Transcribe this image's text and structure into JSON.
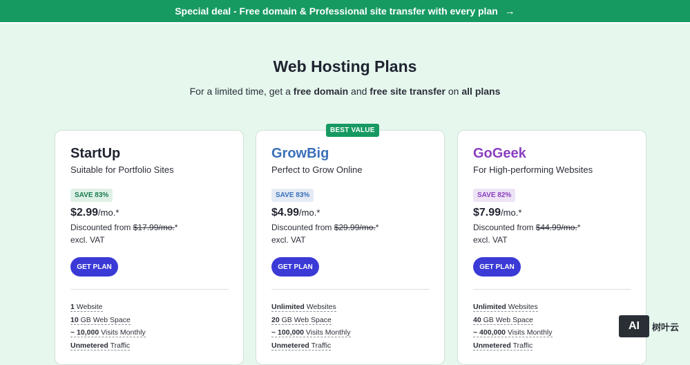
{
  "banner": {
    "text": "Special deal - Free domain & Professional site transfer with every plan",
    "arrow_icon": "→"
  },
  "header": {
    "title": "Web Hosting Plans",
    "subtitle": {
      "p1": "For a limited time, get a ",
      "b1": "free domain",
      "p2": " and ",
      "b2": "free site transfer",
      "p3": " on ",
      "b3": "all plans"
    }
  },
  "best_value_badge": "BEST VALUE",
  "plans": [
    {
      "name": "StartUp",
      "name_color": "#1f2330",
      "desc": "Suitable for Portfolio Sites",
      "save": "SAVE 83%",
      "save_bg": "#dff1e6",
      "save_color": "#1a7a4f",
      "price": "$2.99",
      "per": "/mo.*",
      "disc_prefix": "Discounted from ",
      "orig_price": "$17.99/mo.",
      "disc_suffix": "*",
      "vat": "excl. VAT",
      "button": "GET PLAN",
      "features": [
        {
          "value": "1",
          "label": " Website"
        },
        {
          "value": "10",
          "label": " GB Web Space"
        },
        {
          "value": "~ 10,000",
          "label": " Visits Monthly"
        },
        {
          "value": "Unmetered",
          "label": " Traffic"
        }
      ]
    },
    {
      "name": "GrowBig",
      "name_color": "#3a6fb8",
      "desc": "Perfect to Grow Online",
      "save": "SAVE 83%",
      "save_bg": "#e4ebf5",
      "save_color": "#3a6fb8",
      "price": "$4.99",
      "per": "/mo.*",
      "disc_prefix": "Discounted from ",
      "orig_price": "$29.99/mo.",
      "disc_suffix": "*",
      "vat": "excl. VAT",
      "button": "GET PLAN",
      "features": [
        {
          "value": "Unlimited",
          "label": " Websites"
        },
        {
          "value": "20",
          "label": " GB Web Space"
        },
        {
          "value": "~ 100,000",
          "label": " Visits Monthly"
        },
        {
          "value": "Unmetered",
          "label": " Traffic"
        }
      ]
    },
    {
      "name": "GoGeek",
      "name_color": "#8a3fc1",
      "desc": "For High-performing Websites",
      "save": "SAVE 82%",
      "save_bg": "#ede3f5",
      "save_color": "#8a3fc1",
      "price": "$7.99",
      "per": "/mo.*",
      "disc_prefix": "Discounted from ",
      "orig_price": "$44.99/mo.",
      "disc_suffix": "*",
      "vat": "excl. VAT",
      "button": "GET PLAN",
      "features": [
        {
          "value": "Unlimited",
          "label": " Websites"
        },
        {
          "value": "40",
          "label": " GB Web Space"
        },
        {
          "value": "~ 400,000",
          "label": " Visits Monthly"
        },
        {
          "value": "Unmetered",
          "label": " Traffic"
        }
      ]
    }
  ],
  "colors": {
    "banner_bg": "#179a62",
    "page_bg": "#e6f7ee",
    "button_bg": "#3b3ad6"
  },
  "watermark": {
    "logo_text": "AI",
    "text": "树叶云"
  }
}
